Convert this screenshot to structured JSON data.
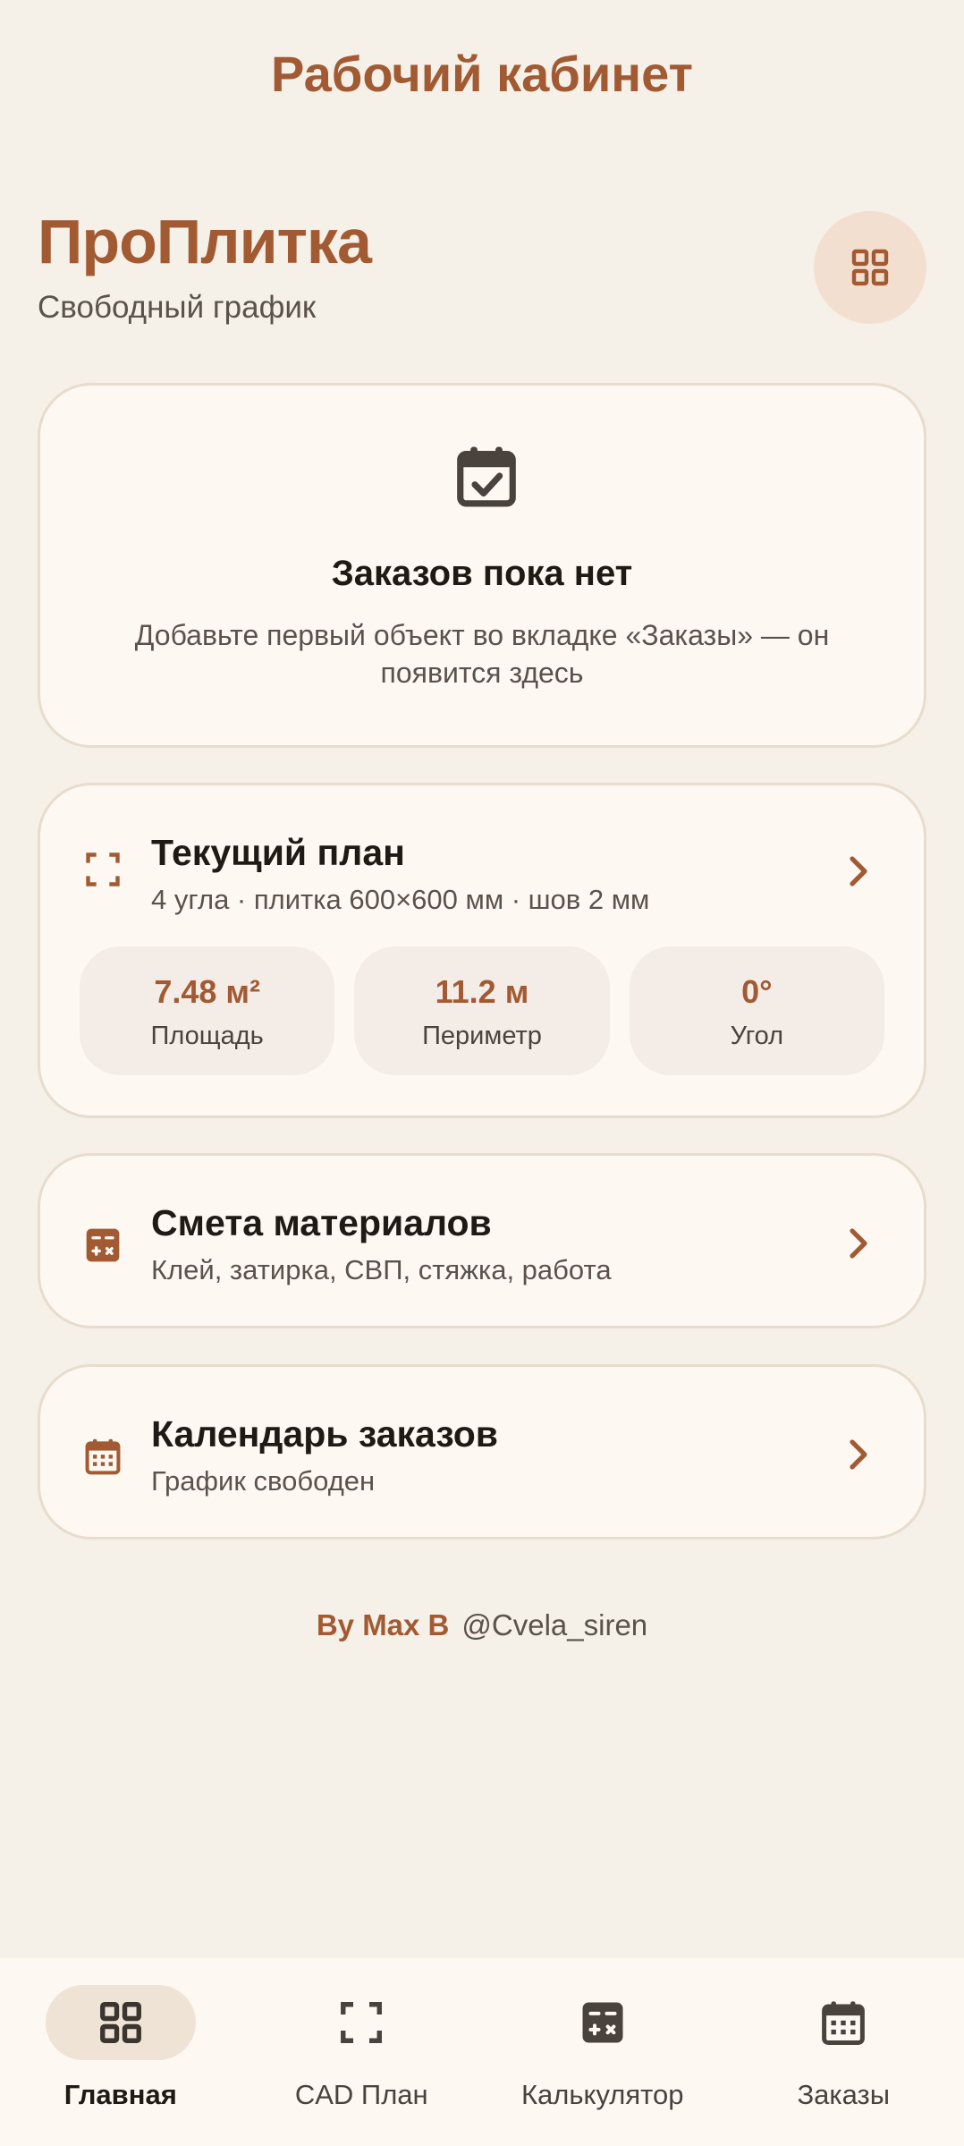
{
  "header": {
    "title": "Рабочий кабинет"
  },
  "brand": {
    "name": "ПроПлитка",
    "subtitle": "Свободный график",
    "menu_icon": "grid-icon"
  },
  "empty_state": {
    "icon": "calendar-check-icon",
    "title": "Заказов пока нет",
    "text": "Добавьте первый объект во вкладке «Заказы» — он появится здесь"
  },
  "plan": {
    "icon": "frame-corners-icon",
    "title": "Текущий план",
    "subtitle": "4 угла · плитка 600×600 мм · шов 2 мм",
    "stats": [
      {
        "value": "7.48 м²",
        "label": "Площадь"
      },
      {
        "value": "11.2 м",
        "label": "Периметр"
      },
      {
        "value": "0°",
        "label": "Угол"
      }
    ]
  },
  "estimate": {
    "icon": "calculator-icon",
    "title": "Смета материалов",
    "subtitle": "Клей, затирка, СВП, стяжка, работа"
  },
  "calendar": {
    "icon": "calendar-icon",
    "title": "Календарь заказов",
    "subtitle": "График свободен"
  },
  "credit": {
    "name": "By Max B",
    "handle": "@Cvela_siren"
  },
  "nav": {
    "items": [
      {
        "label": "Главная",
        "icon": "grid-icon",
        "active": true
      },
      {
        "label": "CAD План",
        "icon": "frame-corners-icon",
        "active": false
      },
      {
        "label": "Калькулятор",
        "icon": "calculator-icon",
        "active": false
      },
      {
        "label": "Заказы",
        "icon": "calendar-icon",
        "active": false
      }
    ]
  },
  "colors": {
    "accent": "#a25a33",
    "background": "#f5f0e8",
    "card": "#fdf9f2",
    "icon_dark": "#4a423c"
  }
}
